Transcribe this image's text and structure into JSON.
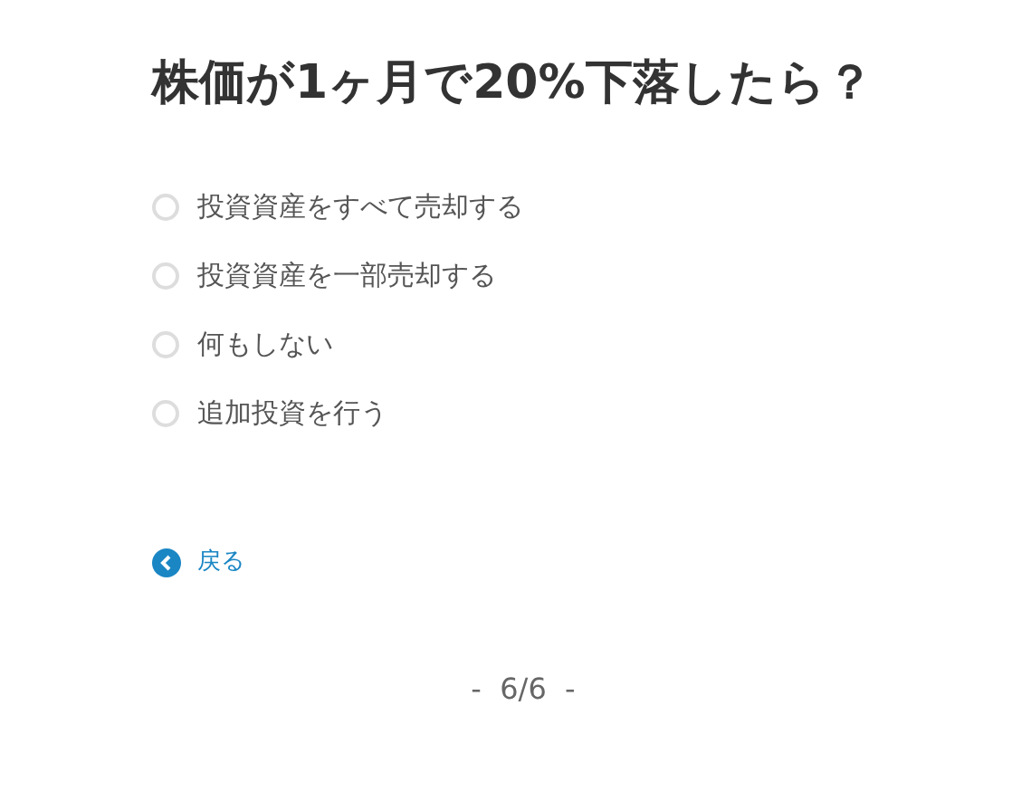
{
  "question": "株価が1ヶ月で20%下落したら？",
  "options": [
    {
      "label": "投資資産をすべて売却する",
      "selected": false
    },
    {
      "label": "投資資産を一部売却する",
      "selected": false
    },
    {
      "label": "何もしない",
      "selected": false
    },
    {
      "label": "追加投資を行う",
      "selected": false
    }
  ],
  "back": "戻る",
  "pager": "-  6/6  -"
}
